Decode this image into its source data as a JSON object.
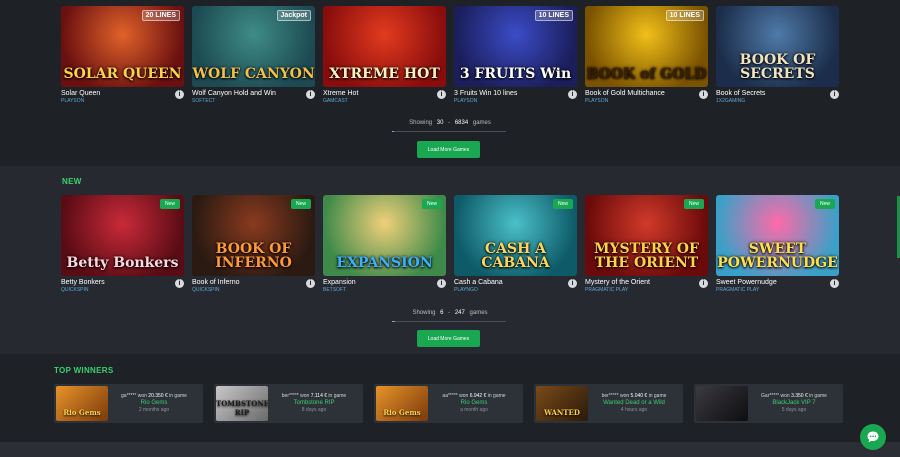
{
  "featured": {
    "games": [
      {
        "name": "Solar Queen",
        "provider": "Playson",
        "art": "SOLAR QUEEN",
        "badge": "20 LINES",
        "colors": [
          "#6b1010",
          "#e0622a"
        ],
        "titleColor": "#ffd24a"
      },
      {
        "name": "Wolf Canyon Hold and Win",
        "provider": "Softect",
        "art": "WOLF CANYON",
        "badge": "Jackpot",
        "colors": [
          "#1d4a52",
          "#3e8c88"
        ],
        "titleColor": "#f2c14a"
      },
      {
        "name": "Xtreme Hot",
        "provider": "Gamcast",
        "art": "XTREME HOT",
        "badge": "",
        "colors": [
          "#8a0d0d",
          "#e23b1e"
        ],
        "titleColor": "#fff2c0"
      },
      {
        "name": "3 Fruits Win 10 lines",
        "provider": "Playson",
        "art": "3 FRUITS Win",
        "badge": "10 LINES",
        "colors": [
          "#1b1e5a",
          "#3b4cc7"
        ],
        "titleColor": "#ffffff"
      },
      {
        "name": "Book of Gold Multichance",
        "provider": "Playson",
        "art": "BOOK of GOLD",
        "badge": "10 LINES",
        "colors": [
          "#7a5200",
          "#f2c019"
        ],
        "titleColor": "#3a1f00"
      },
      {
        "name": "Book of Secrets",
        "provider": "1x2Gaming",
        "art": "BOOK OF SECRETS",
        "badge": "",
        "colors": [
          "#1b2d4a",
          "#4f7aa8"
        ],
        "titleColor": "#f0e3c0"
      }
    ],
    "showing_label": "Showing",
    "shown_count": "30",
    "separator": "-",
    "total_count": "6834",
    "games_label": "games",
    "progress": 0.0044,
    "load_more": "Load More Games"
  },
  "new_section": {
    "title": "NEW",
    "badge": "New",
    "games": [
      {
        "name": "Betty Bonkers",
        "provider": "Quickspin",
        "art": "Betty Bonkers",
        "colors": [
          "#5a0c14",
          "#c92a3a"
        ],
        "titleColor": "#ffd8e0"
      },
      {
        "name": "Book of Inferno",
        "provider": "Quickspin",
        "art": "BOOK OF INFERNO",
        "colors": [
          "#2a1a12",
          "#8a3a1e"
        ],
        "titleColor": "#ff9a3a"
      },
      {
        "name": "Expansion",
        "provider": "Betsoft",
        "art": "EXPANSION",
        "colors": [
          "#3f8a4a",
          "#f0d07a"
        ],
        "titleColor": "#3ab0ff"
      },
      {
        "name": "Cash a Cabana",
        "provider": "Playngo",
        "art": "CASH A CABANA",
        "colors": [
          "#0e5a68",
          "#4ac0c8"
        ],
        "titleColor": "#ffd65a"
      },
      {
        "name": "Mystery of the Orient",
        "provider": "Pragmatic Play",
        "art": "MYSTERY OF THE ORIENT",
        "colors": [
          "#6a0a0a",
          "#d23a2a"
        ],
        "titleColor": "#ffd24a"
      },
      {
        "name": "Sweet Powernudge",
        "provider": "Pragmatic Play",
        "art": "SWEET POWERNUDGE",
        "colors": [
          "#3aa0c8",
          "#ff6aa8"
        ],
        "titleColor": "#ffe04a"
      }
    ],
    "showing_label": "Showing",
    "shown_count": "6",
    "separator": "-",
    "total_count": "247",
    "games_label": "games",
    "progress": 0.024,
    "load_more": "Load More Games"
  },
  "winners": {
    "title": "TOP WINNERS",
    "items": [
      {
        "user": "ga*****",
        "won": "won",
        "amount": "20.350 €",
        "in_game": "in game",
        "game": "Rio Gems",
        "time": "2 months ago",
        "thumb": "Rio Gems",
        "colors": [
          "#7a3a0a",
          "#e8932a"
        ]
      },
      {
        "user": "ber*****",
        "won": "won",
        "amount": "7.114 €",
        "in_game": "in game",
        "game": "Tombstone RIP",
        "time": "8 days ago",
        "thumb": "TOMBSTONE RIP",
        "colors": [
          "#6a6a6a",
          "#c8c8c8"
        ]
      },
      {
        "user": "aa*****",
        "won": "won",
        "amount": "6.942 €",
        "in_game": "in game",
        "game": "Rio Gems",
        "time": "a month ago",
        "thumb": "Rio Gems",
        "colors": [
          "#7a3a0a",
          "#e8932a"
        ]
      },
      {
        "user": "ber*****",
        "won": "won",
        "amount": "5.040 €",
        "in_game": "in game",
        "game": "Wanted Dead or a Wild",
        "time": "4 hours ago",
        "thumb": "WANTED",
        "colors": [
          "#2a1a0a",
          "#7a4a1a"
        ]
      },
      {
        "user": "Gar*****",
        "won": "won",
        "amount": "3.350 €",
        "in_game": "in game",
        "game": "BlackJack VIP 7",
        "time": "5 days ago",
        "thumb": "",
        "colors": [
          "#0e0e10",
          "#3a3a40"
        ]
      }
    ]
  },
  "accent": "#19a851",
  "chat_icon": "chat-bubble-icon"
}
